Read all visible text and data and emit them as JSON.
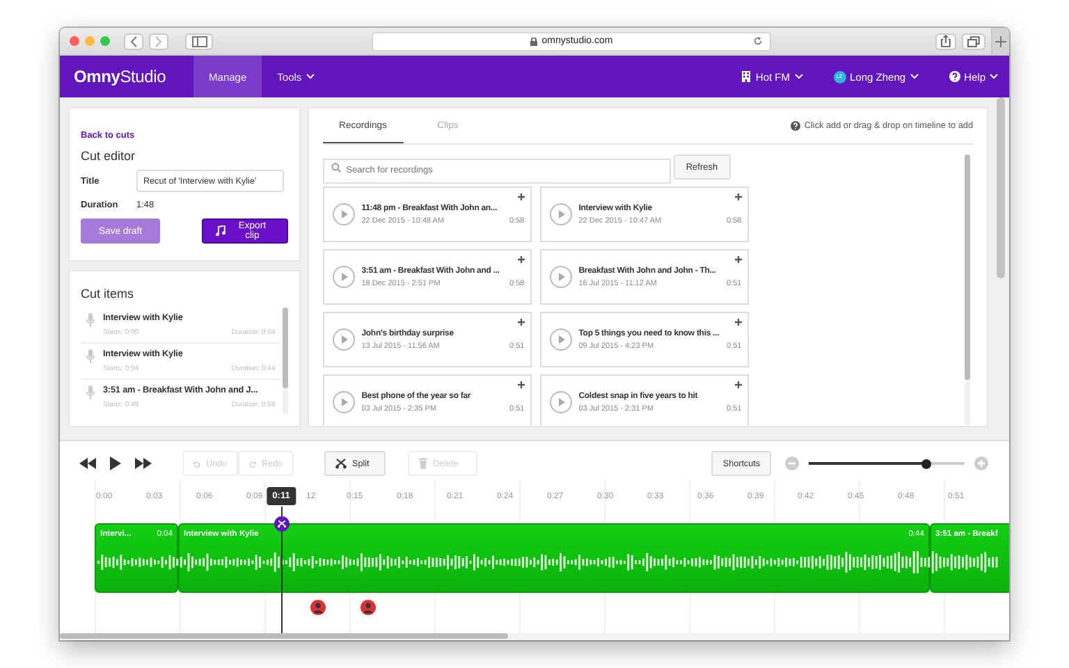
{
  "browser": {
    "url": "omnystudio.com"
  },
  "nav": {
    "logo": "**Omny**Studio",
    "items": [
      {
        "label": "Manage",
        "selected": true,
        "dropdown": false
      },
      {
        "label": "Tools",
        "selected": false,
        "dropdown": true
      }
    ],
    "right": [
      {
        "label": "Hot FM",
        "kind": "station"
      },
      {
        "label": "Long Zheng",
        "kind": "user",
        "initials": "LZ"
      },
      {
        "label": "Help",
        "kind": "help"
      }
    ]
  },
  "editor": {
    "back_link": "Back to cuts",
    "heading": "Cut editor",
    "title_label": "Title",
    "title_value": "Recut of 'Interview with Kylie'",
    "duration_label": "Duration",
    "duration_value": "1:48",
    "buttons": [
      {
        "label": "Save draft",
        "kind": "plain",
        "disabled": true
      },
      {
        "label": "Export clip",
        "kind": "export",
        "disabled": false
      }
    ]
  },
  "cut_items": {
    "heading": "Cut items",
    "items": [
      {
        "title": "Interview with Kylie",
        "starts": "Starts: 0:00",
        "duration": "Duration: 0:04"
      },
      {
        "title": "Interview with Kylie",
        "starts": "Starts: 0:04",
        "duration": "Duration: 0:44"
      },
      {
        "title": "3:51 am - Breakfast With John and J...",
        "starts": "Starts: 0:49",
        "duration": "Duration: 0:58"
      }
    ]
  },
  "library": {
    "tabs": [
      {
        "label": "Recordings",
        "selected": true
      },
      {
        "label": "Clips",
        "selected": false
      }
    ],
    "hint": "Click add or drag & drop on timeline to add",
    "search": {
      "placeholder": "Search for recordings"
    },
    "refresh": "Refresh",
    "recordings": [
      {
        "title": "11:48 pm - Breakfast With John an...",
        "date": "22 Dec 2015 - 10:48 AM",
        "duration": "0:58"
      },
      {
        "title": "Interview with Kylie",
        "date": "22 Dec 2015 - 10:47 AM",
        "duration": "0:58"
      },
      {
        "title": "3:51 am - Breakfast With John and ...",
        "date": "18 Dec 2015 - 2:51 PM",
        "duration": "0:58"
      },
      {
        "title": "Breakfast With John and John - Th...",
        "date": "16 Jul 2015 - 11:12 AM",
        "duration": "0:51"
      },
      {
        "title": "John's birthday surprise",
        "date": "13 Jul 2015 - 11:56 AM",
        "duration": "0:51"
      },
      {
        "title": "Top 5 things you need to know this ...",
        "date": "09 Jul 2015 - 4:23 PM",
        "duration": "0:51"
      },
      {
        "title": "Best phone of the year so far",
        "date": "03 Jul 2015 - 2:35 PM",
        "duration": "0:51"
      },
      {
        "title": "Coldest snap in five years to hit",
        "date": "03 Jul 2015 - 2:31 PM",
        "duration": "0:51"
      }
    ]
  },
  "timeline": {
    "undo": {
      "label": "Undo",
      "disabled": true
    },
    "redo": {
      "label": "Redo",
      "disabled": true
    },
    "split": {
      "label": "Split",
      "disabled": false
    },
    "delete": {
      "label": "Delete",
      "disabled": true
    },
    "shortcuts": "Shortcuts",
    "zoom": {
      "level": 0.75
    },
    "ticks": [
      {
        "label": "0:00",
        "kind": "full"
      },
      {
        "label": "0:03",
        "kind": "full"
      },
      {
        "label": "0:06",
        "kind": "full"
      },
      {
        "label": "0:09",
        "kind": "full"
      },
      {
        "label": "12",
        "kind": "partial"
      },
      {
        "label": "0:15",
        "kind": "full"
      },
      {
        "label": "0:18",
        "kind": "full"
      },
      {
        "label": "0:21",
        "kind": "full"
      },
      {
        "label": "0:24",
        "kind": "full"
      },
      {
        "label": "0:27",
        "kind": "full"
      },
      {
        "label": "0:30",
        "kind": "full"
      },
      {
        "label": "0:33",
        "kind": "full"
      },
      {
        "label": "0:36",
        "kind": "full"
      },
      {
        "label": "0:39",
        "kind": "full"
      },
      {
        "label": "0:42",
        "kind": "full"
      },
      {
        "label": "0:45",
        "kind": "full"
      },
      {
        "label": "0:48",
        "kind": "full"
      },
      {
        "label": "0:51",
        "kind": "full"
      }
    ],
    "playhead": "0:11",
    "clips": [
      {
        "title": "Intervi...",
        "duration": "0:04"
      },
      {
        "title": "Interview with Kylie",
        "duration": "0:44"
      },
      {
        "title": "3:51 am - Breakf"
      }
    ]
  }
}
